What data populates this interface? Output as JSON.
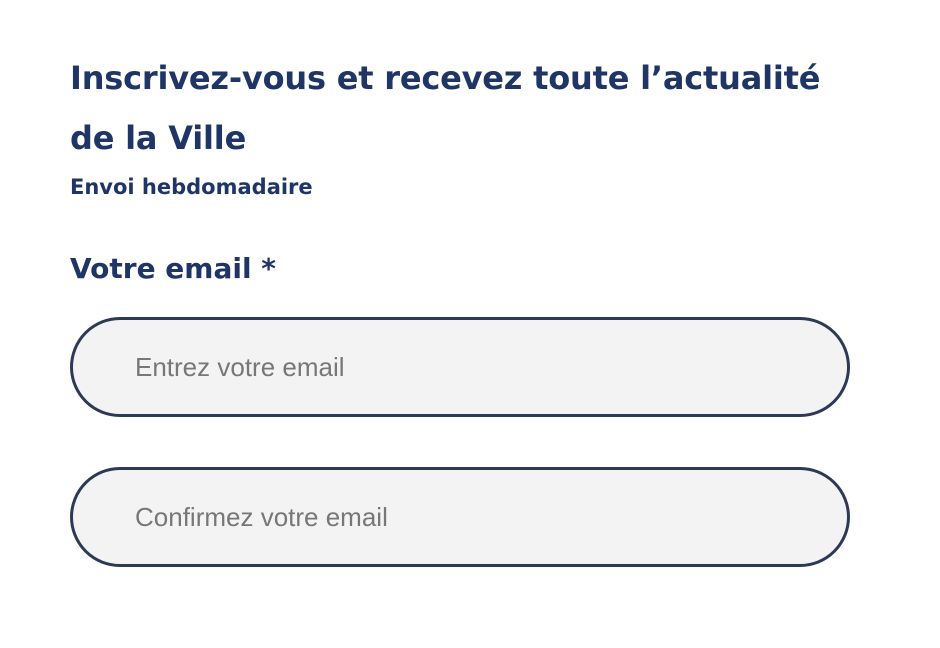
{
  "newsletter": {
    "title": "Inscrivez-vous et recevez toute l’actualité de la Ville",
    "subtitle": "Envoi hebdomadaire",
    "email_label": "Votre email *",
    "email_placeholder": "Entrez votre email",
    "confirm_placeholder": "Confirmez votre email",
    "email_value": "",
    "confirm_value": ""
  },
  "colors": {
    "heading": "#1f3566",
    "input_border": "#2c3a55",
    "input_background": "#f3f3f3",
    "placeholder": "#777777"
  }
}
